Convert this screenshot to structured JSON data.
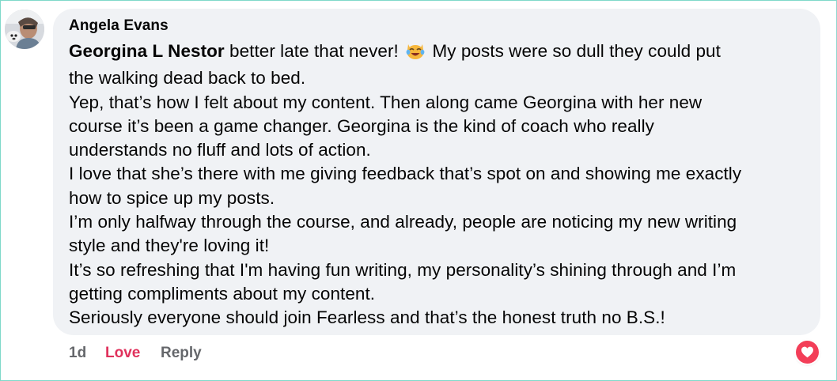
{
  "comment": {
    "author": "Angela Evans",
    "mention": "Georgina L Nestor",
    "lines": [
      "better late that never! ",
      " My posts were so dull they could put",
      "the walking dead back to bed.",
      "Yep, that’s how I felt about my content. Then along came Georgina with her new",
      "course it’s been a game changer. Georgina is the kind of coach who really",
      "understands no fluff and lots of action.",
      "I love that she’s there with me giving feedback that’s spot on and showing me exactly",
      "how to spice up my posts.",
      "I’m only halfway through the course, and already, people are noticing my new writing",
      "style and they're loving it!",
      "It’s so refreshing that I'm having fun writing, my personality’s shining through and I’m",
      "getting compliments about my content.",
      "Seriously everyone should join Fearless and that’s the honest truth no B.S.!"
    ],
    "emoji": "laughing-cat-emoji"
  },
  "actions": {
    "time": "1d",
    "reaction_label": "Love",
    "reply_label": "Reply"
  },
  "reaction": {
    "icon": "love-heart-icon",
    "color": "#f33e58"
  },
  "colors": {
    "bubble": "#f0f2f5",
    "love_accent": "#e0315c",
    "muted": "#65676b"
  }
}
